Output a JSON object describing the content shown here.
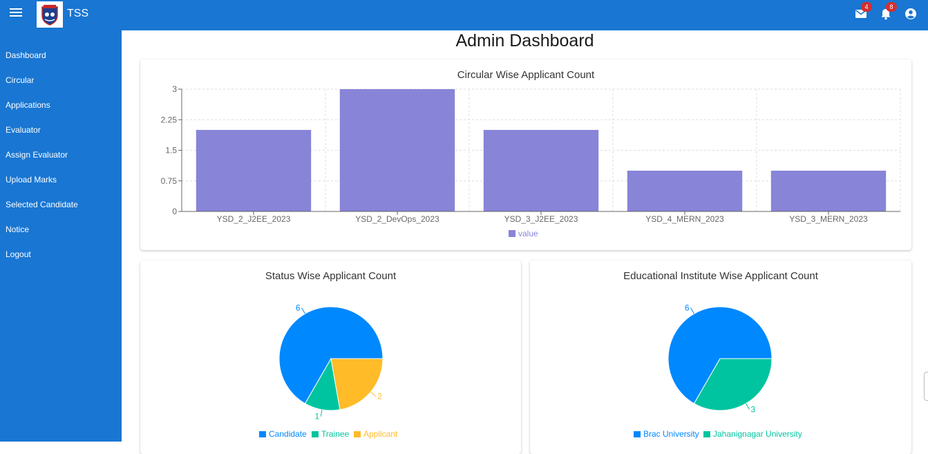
{
  "app": {
    "name": "TSS",
    "mail_count": "4",
    "notification_count": "8"
  },
  "sidebar": {
    "items": [
      {
        "label": "Dashboard"
      },
      {
        "label": "Circular"
      },
      {
        "label": "Applications"
      },
      {
        "label": "Evaluator"
      },
      {
        "label": "Assign Evaluator"
      },
      {
        "label": "Upload Marks"
      },
      {
        "label": "Selected Candidate"
      },
      {
        "label": "Notice"
      },
      {
        "label": "Logout"
      }
    ]
  },
  "page": {
    "title": "Admin Dashboard"
  },
  "chart_data": [
    {
      "type": "bar",
      "title": "Circular Wise Applicant Count",
      "categories": [
        "YSD_2_J2EE_2023",
        "YSD_2_DevOps_2023",
        "YSD_3_J2EE_2023",
        "YSD_4_MERN_2023",
        "YSD_3_MERN_2023"
      ],
      "series": [
        {
          "name": "value",
          "values": [
            2,
            3,
            2,
            1,
            1
          ]
        }
      ],
      "yticks": [
        "0",
        "0.75",
        "1.5",
        "2.25",
        "3"
      ],
      "ylim": [
        0,
        3
      ],
      "grid": true,
      "legend": "bottom",
      "color": "#8884d8"
    },
    {
      "type": "pie",
      "title": "Status Wise Applicant Count",
      "labels": [
        "Candidate",
        "Trainee",
        "Applicant"
      ],
      "values": [
        6,
        1,
        2
      ],
      "value_labels": [
        "6",
        "1",
        "2"
      ],
      "colors": [
        "#0088fe",
        "#00c49f",
        "#ffbb28"
      ],
      "legend": "bottom"
    },
    {
      "type": "pie",
      "title": "Educational Institute Wise Applicant Count",
      "labels": [
        "Brac University",
        "Jahanignagar University"
      ],
      "values": [
        6,
        3
      ],
      "value_labels": [
        "6",
        "3"
      ],
      "colors": [
        "#0088fe",
        "#00c49f"
      ],
      "legend": "bottom"
    }
  ]
}
